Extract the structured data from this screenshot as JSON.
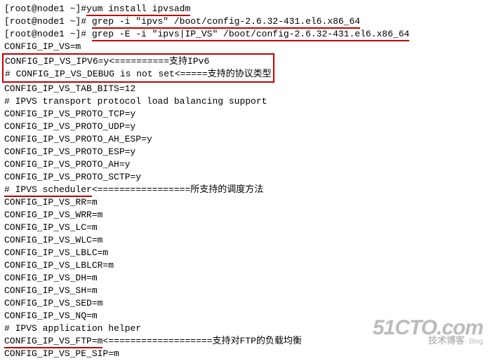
{
  "terminal": {
    "line1_prompt": "[root@node1 ~]#",
    "line1_cmd": "yum install ipvsadm",
    "line2_prompt": "[root@node1 ~]# ",
    "line2_cmd": "grep -i \"ipvs\" /boot/config-2.6.32-431.el6.x86_64",
    "line3_prompt": "[root@node1 ~]# ",
    "line3_cmd": "grep -E -i \"ipvs|IP_VS\" /boot/config-2.6.32-431.el6.x86_64",
    "l4": "CONFIG_IP_VS=m",
    "box_l1": "CONFIG_IP_VS_IPV6=y<==========支持IPv6",
    "box_l2": "# CONFIG_IP_VS_DEBUG is not set<=====支持的协议类型",
    "l7": "CONFIG_IP_VS_TAB_BITS=12",
    "l8": "# IPVS transport protocol load balancing support",
    "l9": "CONFIG_IP_VS_PROTO_TCP=y",
    "l10": "CONFIG_IP_VS_PROTO_UDP=y",
    "l11": "CONFIG_IP_VS_PROTO_AH_ESP=y",
    "l12": "CONFIG_IP_VS_PROTO_ESP=y",
    "l13": "CONFIG_IP_VS_PROTO_AH=y",
    "l14": "CONFIG_IP_VS_PROTO_SCTP=y",
    "l15_a": "# IPVS scheduler",
    "l15_b": "<=================所支持的调度方法",
    "l16": "CONFIG_IP_VS_RR=m",
    "l17": "CONFIG_IP_VS_WRR=m",
    "l18": "CONFIG_IP_VS_LC=m",
    "l19": "CONFIG_IP_VS_WLC=m",
    "l20": "CONFIG_IP_VS_LBLC=m",
    "l21": "CONFIG_IP_VS_LBLCR=m",
    "l22": "CONFIG_IP_VS_DH=m",
    "l23": "CONFIG_IP_VS_SH=m",
    "l24": "CONFIG_IP_VS_SED=m",
    "l25": "CONFIG_IP_VS_NQ=m",
    "l26": "# IPVS application helper",
    "l27_a": "CONFIG_IP_VS_FTP=m",
    "l27_b": "<===================支持对FTP的负载均衡",
    "l28": "CONFIG_IP_VS_PE_SIP=m"
  },
  "watermark": {
    "title": "51CTO.com",
    "subtitle": "技术博客",
    "blog": "Blog"
  }
}
